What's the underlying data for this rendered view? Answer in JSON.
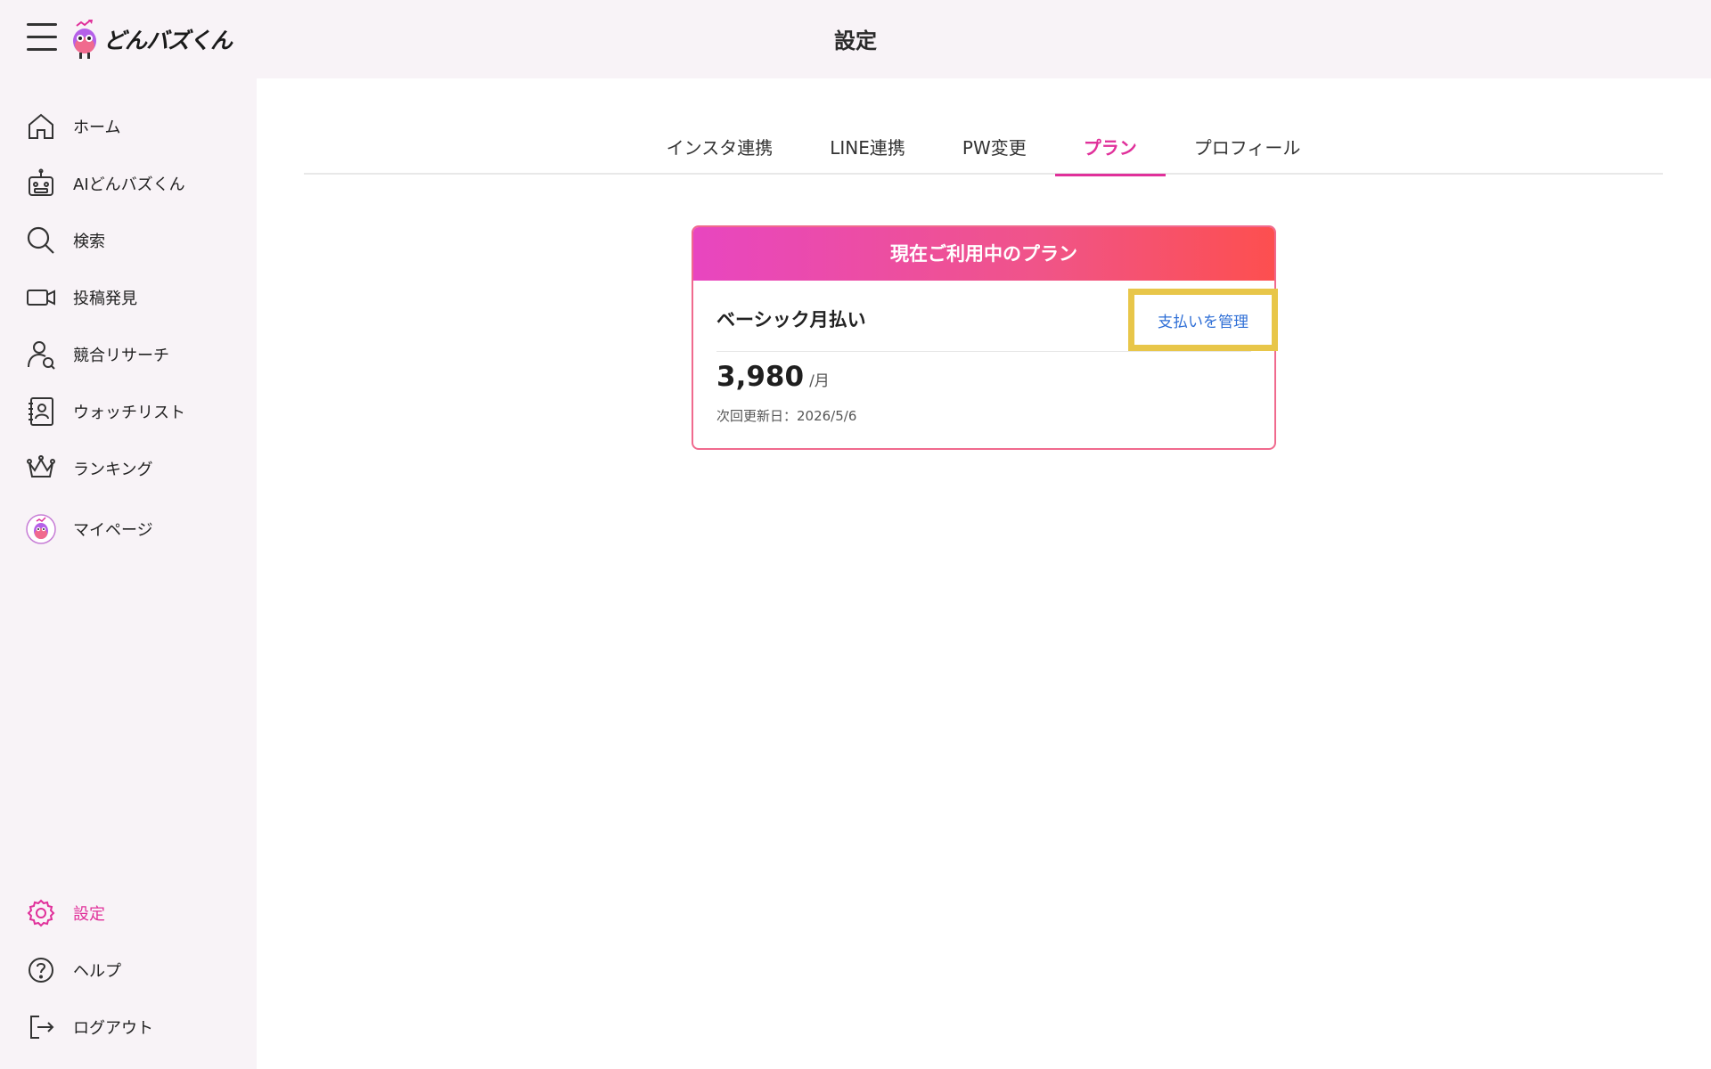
{
  "header": {
    "brand": "どんバズくん",
    "page_title": "設定"
  },
  "sidebar": {
    "items": [
      {
        "label": "ホーム",
        "icon": "home-icon"
      },
      {
        "label": "AIどんバズくん",
        "icon": "robot-icon"
      },
      {
        "label": "検索",
        "icon": "search-icon"
      },
      {
        "label": "投稿発見",
        "icon": "video-camera-icon"
      },
      {
        "label": "競合リサーチ",
        "icon": "user-search-icon"
      },
      {
        "label": "ウォッチリスト",
        "icon": "contact-book-icon"
      },
      {
        "label": "ランキング",
        "icon": "crown-icon"
      },
      {
        "label": "マイページ",
        "icon": "avatar-icon"
      }
    ],
    "bottom_items": [
      {
        "label": "設定",
        "icon": "gear-icon",
        "active": true
      },
      {
        "label": "ヘルプ",
        "icon": "help-circle-icon"
      },
      {
        "label": "ログアウト",
        "icon": "logout-icon"
      }
    ]
  },
  "tabs": [
    {
      "label": "インスタ連携"
    },
    {
      "label": "LINE連携"
    },
    {
      "label": "PW変更"
    },
    {
      "label": "プラン",
      "active": true
    },
    {
      "label": "プロフィール"
    }
  ],
  "plan": {
    "header": "現在ご利用中のプラン",
    "name": "ベーシック月払い",
    "manage_label": "支払いを管理",
    "price": "3,980",
    "unit": "/月",
    "renewal": "次回更新日：2026/5/6"
  },
  "colors": {
    "accent": "#e0309a",
    "link": "#2f6fd6",
    "highlight": "#e8c649"
  }
}
